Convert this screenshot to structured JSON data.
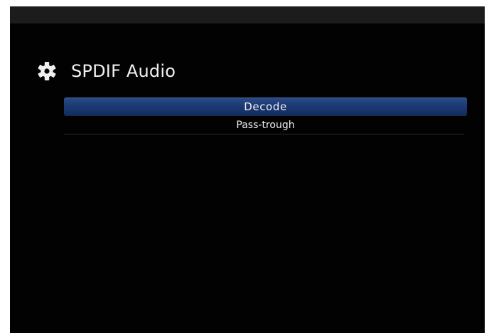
{
  "screen": {
    "title": "SPDIF Audio",
    "title_icon": "gear-icon"
  },
  "menu": {
    "items": [
      {
        "label": "Decode",
        "selected": true
      },
      {
        "label": "Pass-trough",
        "selected": false
      }
    ]
  },
  "colors": {
    "background": "#020202",
    "top_bar": "#1c1c1c",
    "selection": "#1c3a73",
    "text": "#f2f2f2"
  }
}
